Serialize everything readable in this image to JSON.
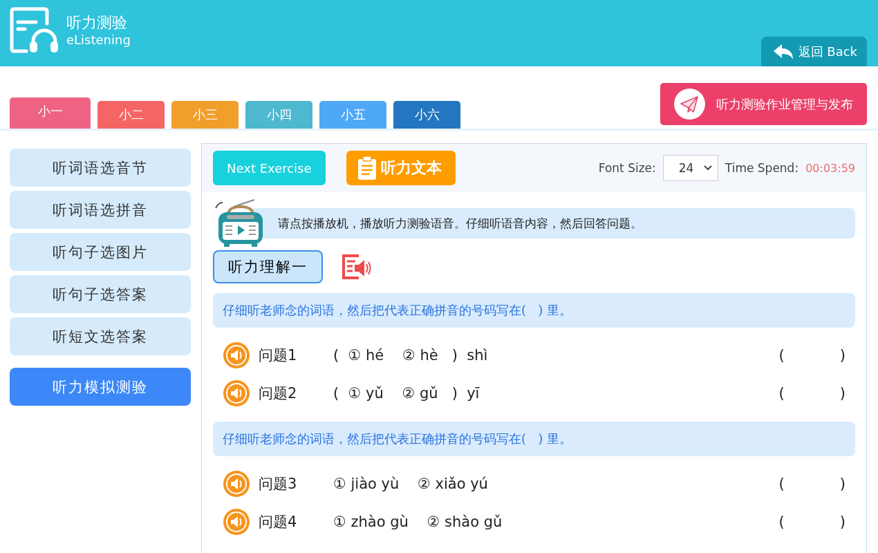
{
  "header": {
    "title": "听力测验",
    "subtitle": "eListening",
    "back_button": "返回 Back"
  },
  "grade_tabs": [
    {
      "label": "小一",
      "selected": true,
      "color": "#ee6384"
    },
    {
      "label": "小二",
      "selected": false,
      "color": "#f56565"
    },
    {
      "label": "小三",
      "selected": false,
      "color": "#f09e2c"
    },
    {
      "label": "小四",
      "selected": false,
      "color": "#4db8cf"
    },
    {
      "label": "小五",
      "selected": false,
      "color": "#4fa8f5"
    },
    {
      "label": "小六",
      "selected": false,
      "color": "#2277c0"
    }
  ],
  "publish_button": "听力测验作业管理与发布",
  "sidebar": {
    "items": [
      {
        "label": "听词语选音节",
        "selected": false
      },
      {
        "label": "听词语选拼音",
        "selected": false
      },
      {
        "label": "听句子选图片",
        "selected": false
      },
      {
        "label": "听句子选答案",
        "selected": false
      },
      {
        "label": "听短文选答案",
        "selected": false
      },
      {
        "label": "听力模拟测验",
        "selected": true
      }
    ]
  },
  "toolbar": {
    "next_button": "Next Exercise",
    "script_button": "听力文本",
    "font_size_label": "Font Size:",
    "font_size": "24",
    "time_label": "Time Spend:",
    "time_value": "00:03:59"
  },
  "instruction": "请点按播放机，播放听力测验语音。仔细听语音内容，然后回答问题。",
  "section_title": "听力理解一",
  "groups": [
    {
      "prompt": "仔细听老师念的词语，然后把代表正确拼音的号码写在(   ) 里。",
      "questions": [
        {
          "label": "问题1",
          "choices": "(  ① hé    ② hè   )  shì",
          "answer": "(            )"
        },
        {
          "label": "问题2",
          "choices": "(  ① yǔ    ② gǔ   )  yī",
          "answer": "(            )"
        }
      ]
    },
    {
      "prompt": "仔细听老师念的词语，然后把代表正确拼音的号码写在(   ) 里。",
      "questions": [
        {
          "label": "问题3",
          "choices": "① jiào yù    ② xiǎo yú",
          "answer": "(            )"
        },
        {
          "label": "问题4",
          "choices": "① zhào gù    ② shào gǔ",
          "answer": "(            )"
        }
      ]
    }
  ]
}
